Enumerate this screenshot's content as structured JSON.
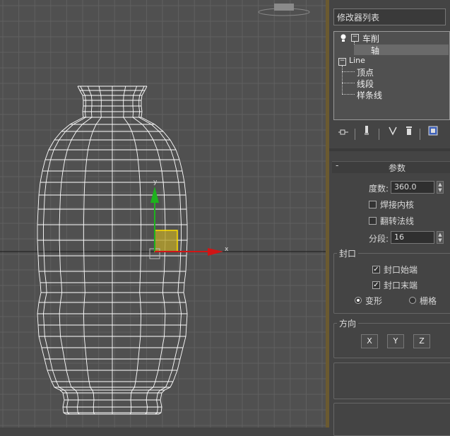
{
  "viewport": {
    "axis_x_label": "x",
    "axis_y_label": "y"
  },
  "panel": {
    "modifier_list_label": "修改器列表",
    "stack": {
      "lathe": "车削",
      "axis": "轴",
      "line": "Line",
      "vertex": "顶点",
      "segment": "线段",
      "spline": "样条线"
    },
    "toolbar_icons": [
      "pin-stack-icon",
      "show-end-result-icon",
      "make-unique-icon",
      "remove-modifier-icon",
      "configure-modifier-sets-icon"
    ],
    "params": {
      "rollout_title": "参数",
      "collapse_sign": "-",
      "degrees_label": "度数:",
      "degrees_value": "360.0",
      "weld_core_label": "焊接内核",
      "weld_core_checked": false,
      "flip_normals_label": "翻转法线",
      "flip_normals_checked": false,
      "segments_label": "分段:",
      "segments_value": "16",
      "capping_title": "封口",
      "cap_start_label": "封口始端",
      "cap_start_checked": true,
      "cap_end_label": "封口末端",
      "cap_end_checked": true,
      "morph_label": "变形",
      "grid_label": "栅格",
      "cap_type_selected": "变形",
      "direction_title": "方向",
      "dir_x": "X",
      "dir_y": "Y",
      "dir_z": "Z"
    }
  }
}
